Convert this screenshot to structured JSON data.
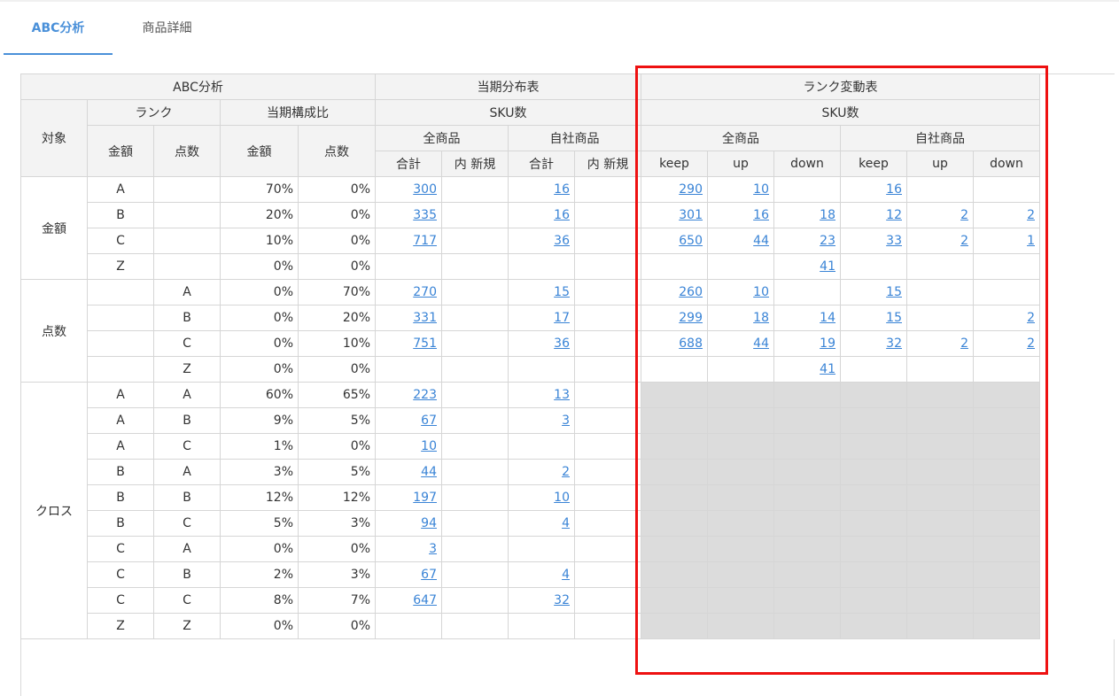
{
  "tabs": [
    {
      "label": "ABC分析",
      "active": true
    },
    {
      "label": "商品詳細",
      "active": false
    }
  ],
  "headers": {
    "abc": "ABC分析",
    "period": "当期分布表",
    "rank_change": "ランク変動表",
    "target": "対象",
    "rank": "ランク",
    "ratio": "当期構成比",
    "sku": "SKU数",
    "all": "全商品",
    "own": "自社商品",
    "amount": "金額",
    "count": "点数",
    "total": "合計",
    "new_in": "内 新規",
    "keep": "keep",
    "up": "up",
    "down": "down"
  },
  "groups": [
    {
      "label": "金額",
      "rows": [
        [
          "A",
          "",
          "70%",
          "0%",
          "300",
          "",
          "16",
          "",
          "290",
          "10",
          "",
          "16",
          "",
          ""
        ],
        [
          "B",
          "",
          "20%",
          "0%",
          "335",
          "",
          "16",
          "",
          "301",
          "16",
          "18",
          "12",
          "2",
          "2"
        ],
        [
          "C",
          "",
          "10%",
          "0%",
          "717",
          "",
          "36",
          "",
          "650",
          "44",
          "23",
          "33",
          "2",
          "1"
        ],
        [
          "Z",
          "",
          "0%",
          "0%",
          "",
          "",
          "",
          "",
          "",
          "",
          "41",
          "",
          "",
          ""
        ]
      ]
    },
    {
      "label": "点数",
      "rows": [
        [
          "",
          "A",
          "0%",
          "70%",
          "270",
          "",
          "15",
          "",
          "260",
          "10",
          "",
          "15",
          "",
          ""
        ],
        [
          "",
          "B",
          "0%",
          "20%",
          "331",
          "",
          "17",
          "",
          "299",
          "18",
          "14",
          "15",
          "",
          "2"
        ],
        [
          "",
          "C",
          "0%",
          "10%",
          "751",
          "",
          "36",
          "",
          "688",
          "44",
          "19",
          "32",
          "2",
          "2"
        ],
        [
          "",
          "Z",
          "0%",
          "0%",
          "",
          "",
          "",
          "",
          "",
          "",
          "41",
          "",
          "",
          ""
        ]
      ]
    },
    {
      "label": "クロス",
      "cross": true,
      "rows": [
        [
          "A",
          "A",
          "60%",
          "65%",
          "223",
          "",
          "13",
          ""
        ],
        [
          "A",
          "B",
          "9%",
          "5%",
          "67",
          "",
          "3",
          ""
        ],
        [
          "A",
          "C",
          "1%",
          "0%",
          "10",
          "",
          "",
          ""
        ],
        [
          "B",
          "A",
          "3%",
          "5%",
          "44",
          "",
          "2",
          ""
        ],
        [
          "B",
          "B",
          "12%",
          "12%",
          "197",
          "",
          "10",
          ""
        ],
        [
          "B",
          "C",
          "5%",
          "3%",
          "94",
          "",
          "4",
          ""
        ],
        [
          "C",
          "A",
          "0%",
          "0%",
          "3",
          "",
          "",
          ""
        ],
        [
          "C",
          "B",
          "2%",
          "3%",
          "67",
          "",
          "4",
          ""
        ],
        [
          "C",
          "C",
          "8%",
          "7%",
          "647",
          "",
          "32",
          ""
        ],
        [
          "Z",
          "Z",
          "0%",
          "0%",
          "",
          "",
          "",
          ""
        ]
      ]
    }
  ],
  "colors": {
    "link": "#3a84d6",
    "highlight": "#ee1111",
    "disabled": "#dcdcdc",
    "tab_active": "#4a90d9"
  }
}
